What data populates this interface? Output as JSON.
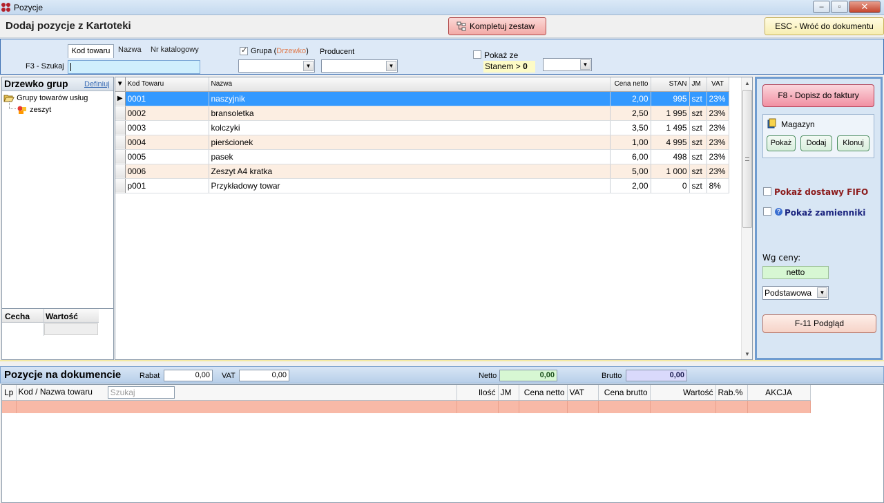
{
  "window": {
    "title": "Pozycje",
    "icon": "app-icon",
    "buttons": [
      "minimize-icon",
      "maximize-icon",
      "close-icon"
    ]
  },
  "header": {
    "title": "Dodaj pozycje z Kartoteki",
    "kompletuj_label": "Kompletuj zestaw",
    "kompletuj_icon": "tree-structure-icon",
    "esc_label": "ESC - Wróć do dokumentu"
  },
  "search": {
    "tabs": [
      "Kod towaru",
      "Nazwa",
      "Nr katalogowy"
    ],
    "label": "F3 - Szukaj",
    "value": "",
    "grupa_label": "Grupa (",
    "grupa_highlight": "Drzewko",
    "grupa_close": ")",
    "grupa_checked": true,
    "producent_label": "Producent",
    "pokaz_label": "Pokaż ze",
    "stanem_label": "Stanem",
    "stanem_op": ">",
    "stanem_value": "0"
  },
  "tree": {
    "title": "Drzewko grup",
    "define_link": "Definiuj",
    "nodes": [
      {
        "label": "Grupy towarów usług",
        "icon": "folder-open-icon"
      },
      {
        "label": "zeszyt",
        "icon": "group-items-icon"
      }
    ]
  },
  "attributes": {
    "col1": "Cecha",
    "col2": "Wartość"
  },
  "grid": {
    "columns": [
      "Kod Towaru",
      "Nazwa",
      "Cena netto",
      "STAN",
      "JM",
      "VAT"
    ],
    "rows": [
      [
        "0001",
        "naszyjnik",
        "2,00",
        "995",
        "szt",
        "23%"
      ],
      [
        "0002",
        "bransoletka",
        "2,50",
        "1 995",
        "szt",
        "23%"
      ],
      [
        "0003",
        "kolczyki",
        "3,50",
        "1 495",
        "szt",
        "23%"
      ],
      [
        "0004",
        "pierścionek",
        "1,00",
        "4 995",
        "szt",
        "23%"
      ],
      [
        "0005",
        "pasek",
        "6,00",
        "498",
        "szt",
        "23%"
      ],
      [
        "0006",
        "Zeszyt A4 kratka",
        "5,00",
        "1 000",
        "szt",
        "23%"
      ],
      [
        "p001",
        "Przykładowy towar",
        "2,00",
        "0",
        "szt",
        "8%"
      ]
    ],
    "selected_row": 0
  },
  "right_panel": {
    "f8_label": "F8 - Dopisz do faktury",
    "magazyn_label": "Magazyn",
    "magazyn_icon": "warehouse-icon",
    "pokaz_btn": "Pokaż",
    "dodaj_btn": "Dodaj",
    "klonuj_btn": "Klonuj",
    "fifo_label": "Pokaż dostawy FIFO",
    "zamienniki_label": "Pokaż zamienniki",
    "zamienniki_icon": "help-icon",
    "wg_ceny_label": "Wg ceny:",
    "netto_value": "netto",
    "cennik_value": "Podstawowa",
    "f11_label": "F-11 Podgląd"
  },
  "document": {
    "title": "Pozycje na dokumencie",
    "rabat_label": "Rabat",
    "rabat_value": "0,00",
    "vat_label": "VAT",
    "vat_value": "0,00",
    "netto_label": "Netto",
    "netto_value": "0,00",
    "brutto_label": "Brutto",
    "brutto_value": "0,00",
    "columns": [
      "Lp",
      "Kod / Nazwa towaru",
      "Ilość",
      "JM",
      "Cena netto",
      "VAT",
      "Cena brutto",
      "Wartość",
      "Rab.%",
      "AKCJA"
    ],
    "search_placeholder": "Szukaj"
  },
  "colors": {
    "accent_blue": "#3399ff",
    "row_alt": "#fceee2",
    "doc_row": "#f8b9a7",
    "netto_green": "#d7f7d3",
    "brutto_lavender": "#d9d9fb",
    "fifo_red": "#8b1a1a",
    "zamienniki_blue": "#1a237e"
  }
}
